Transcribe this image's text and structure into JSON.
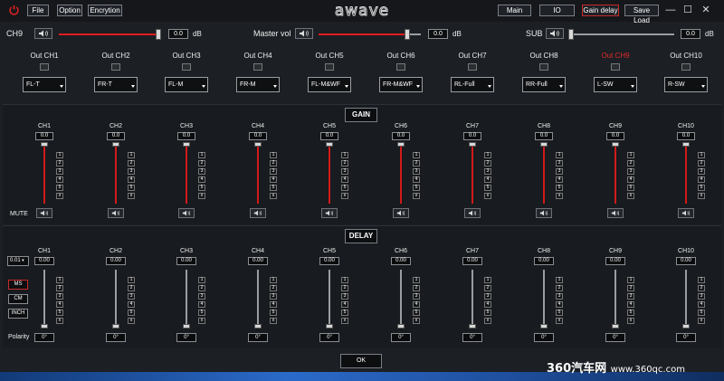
{
  "topbar": {
    "menu": [
      "File",
      "Option",
      "Encrytion"
    ],
    "logo_text": "awave",
    "nav": [
      "Main",
      "IO",
      "Gain delay",
      "Save Load"
    ],
    "active_nav": "Gain delay",
    "window_controls": [
      "minimize-icon",
      "maximize-icon",
      "close-icon"
    ]
  },
  "volume": {
    "ch9": {
      "label": "CH9",
      "value": "0.0",
      "unit": "dB",
      "level_pct": 100
    },
    "master": {
      "label": "Master vol",
      "value": "0.0",
      "unit": "dB",
      "level_pct": 100
    },
    "sub": {
      "label": "SUB",
      "value": "0.0",
      "unit": "dB",
      "level_pct": 0
    }
  },
  "outputs": [
    {
      "label": "Out CH1",
      "assign": "FL-T"
    },
    {
      "label": "Out CH2",
      "assign": "FR-T"
    },
    {
      "label": "Out CH3",
      "assign": "FL-M"
    },
    {
      "label": "Out CH4",
      "assign": "FR-M"
    },
    {
      "label": "Out CH5",
      "assign": "FL-M&WF"
    },
    {
      "label": "Out CH6",
      "assign": "FR-M&WF"
    },
    {
      "label": "Out CH7",
      "assign": "RL-Full"
    },
    {
      "label": "Out CH8",
      "assign": "RR-Full"
    },
    {
      "label": "Out CH9",
      "assign": "L-SW",
      "highlight": true
    },
    {
      "label": "Out CH10",
      "assign": "R-SW"
    }
  ],
  "gain": {
    "title": "GAIN",
    "mute_label": "MUTE",
    "channels": [
      {
        "name": "CH1",
        "value": "0.0"
      },
      {
        "name": "CH2",
        "value": "0.0"
      },
      {
        "name": "CH3",
        "value": "0.0"
      },
      {
        "name": "CH4",
        "value": "0.0"
      },
      {
        "name": "CH5",
        "value": "0.0"
      },
      {
        "name": "CH6",
        "value": "0.0"
      },
      {
        "name": "CH7",
        "value": "0.0"
      },
      {
        "name": "CH8",
        "value": "0.0"
      },
      {
        "name": "CH9",
        "value": "0.0"
      },
      {
        "name": "CH10",
        "value": "0.0"
      }
    ],
    "presets": [
      "1",
      "2",
      "3",
      "4",
      "5",
      "x"
    ]
  },
  "delay": {
    "title": "DELAY",
    "step": "0.01",
    "units": [
      "MS",
      "CM",
      "INCH"
    ],
    "active_unit": "MS",
    "polarity_label": "Polarity",
    "channels": [
      {
        "name": "CH1",
        "value": "0.00",
        "polarity": "0°"
      },
      {
        "name": "CH2",
        "value": "0.00",
        "polarity": "0°"
      },
      {
        "name": "CH3",
        "value": "0.00",
        "polarity": "0°"
      },
      {
        "name": "CH4",
        "value": "0.00",
        "polarity": "0°"
      },
      {
        "name": "CH5",
        "value": "0.00",
        "polarity": "0°"
      },
      {
        "name": "CH6",
        "value": "0.00",
        "polarity": "0°"
      },
      {
        "name": "CH7",
        "value": "0.00",
        "polarity": "0°"
      },
      {
        "name": "CH8",
        "value": "0.00",
        "polarity": "0°"
      },
      {
        "name": "CH9",
        "value": "0.00",
        "polarity": "0°"
      },
      {
        "name": "CH10",
        "value": "0.00",
        "polarity": "0°"
      }
    ],
    "presets": [
      "1",
      "2",
      "3",
      "4",
      "5",
      "x"
    ]
  },
  "ok_label": "OK",
  "watermark": {
    "brand": "360汽车网",
    "url": "www.360qc.com"
  },
  "colors": {
    "accent": "#d21a1a",
    "background": "#1c1f24",
    "taskbar": "#2b6ac9"
  }
}
